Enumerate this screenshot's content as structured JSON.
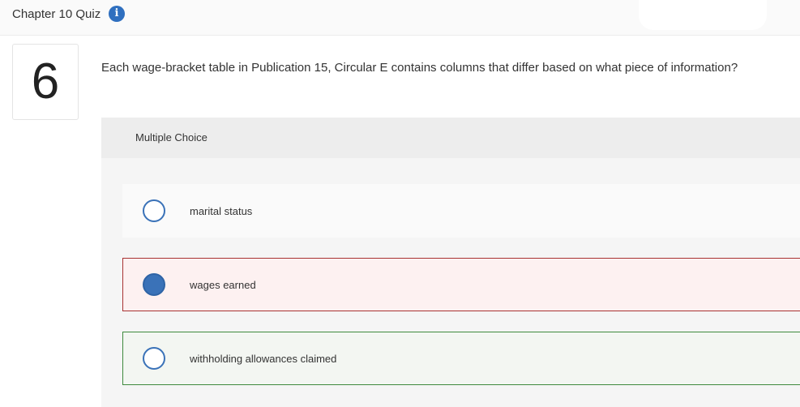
{
  "header": {
    "title": "Chapter 10 Quiz",
    "info_icon": "info-icon",
    "info_glyph": "i"
  },
  "question": {
    "number": "6",
    "text": "Each wage-bracket table in Publication 15, Circular E contains columns that differ based on what piece of information?"
  },
  "multiple_choice": {
    "label": "Multiple Choice",
    "options": [
      {
        "label": "marital status",
        "selected": false,
        "state": "neutral"
      },
      {
        "label": "wages earned",
        "selected": true,
        "state": "incorrect"
      },
      {
        "label": "withholding allowances claimed",
        "selected": false,
        "state": "correct"
      }
    ]
  },
  "colors": {
    "accent": "#3a72b8",
    "incorrect_border": "#a83232",
    "incorrect_bg": "#fdf1f1",
    "correct_border": "#3e8a3e",
    "correct_bg": "#f3f6f2"
  }
}
